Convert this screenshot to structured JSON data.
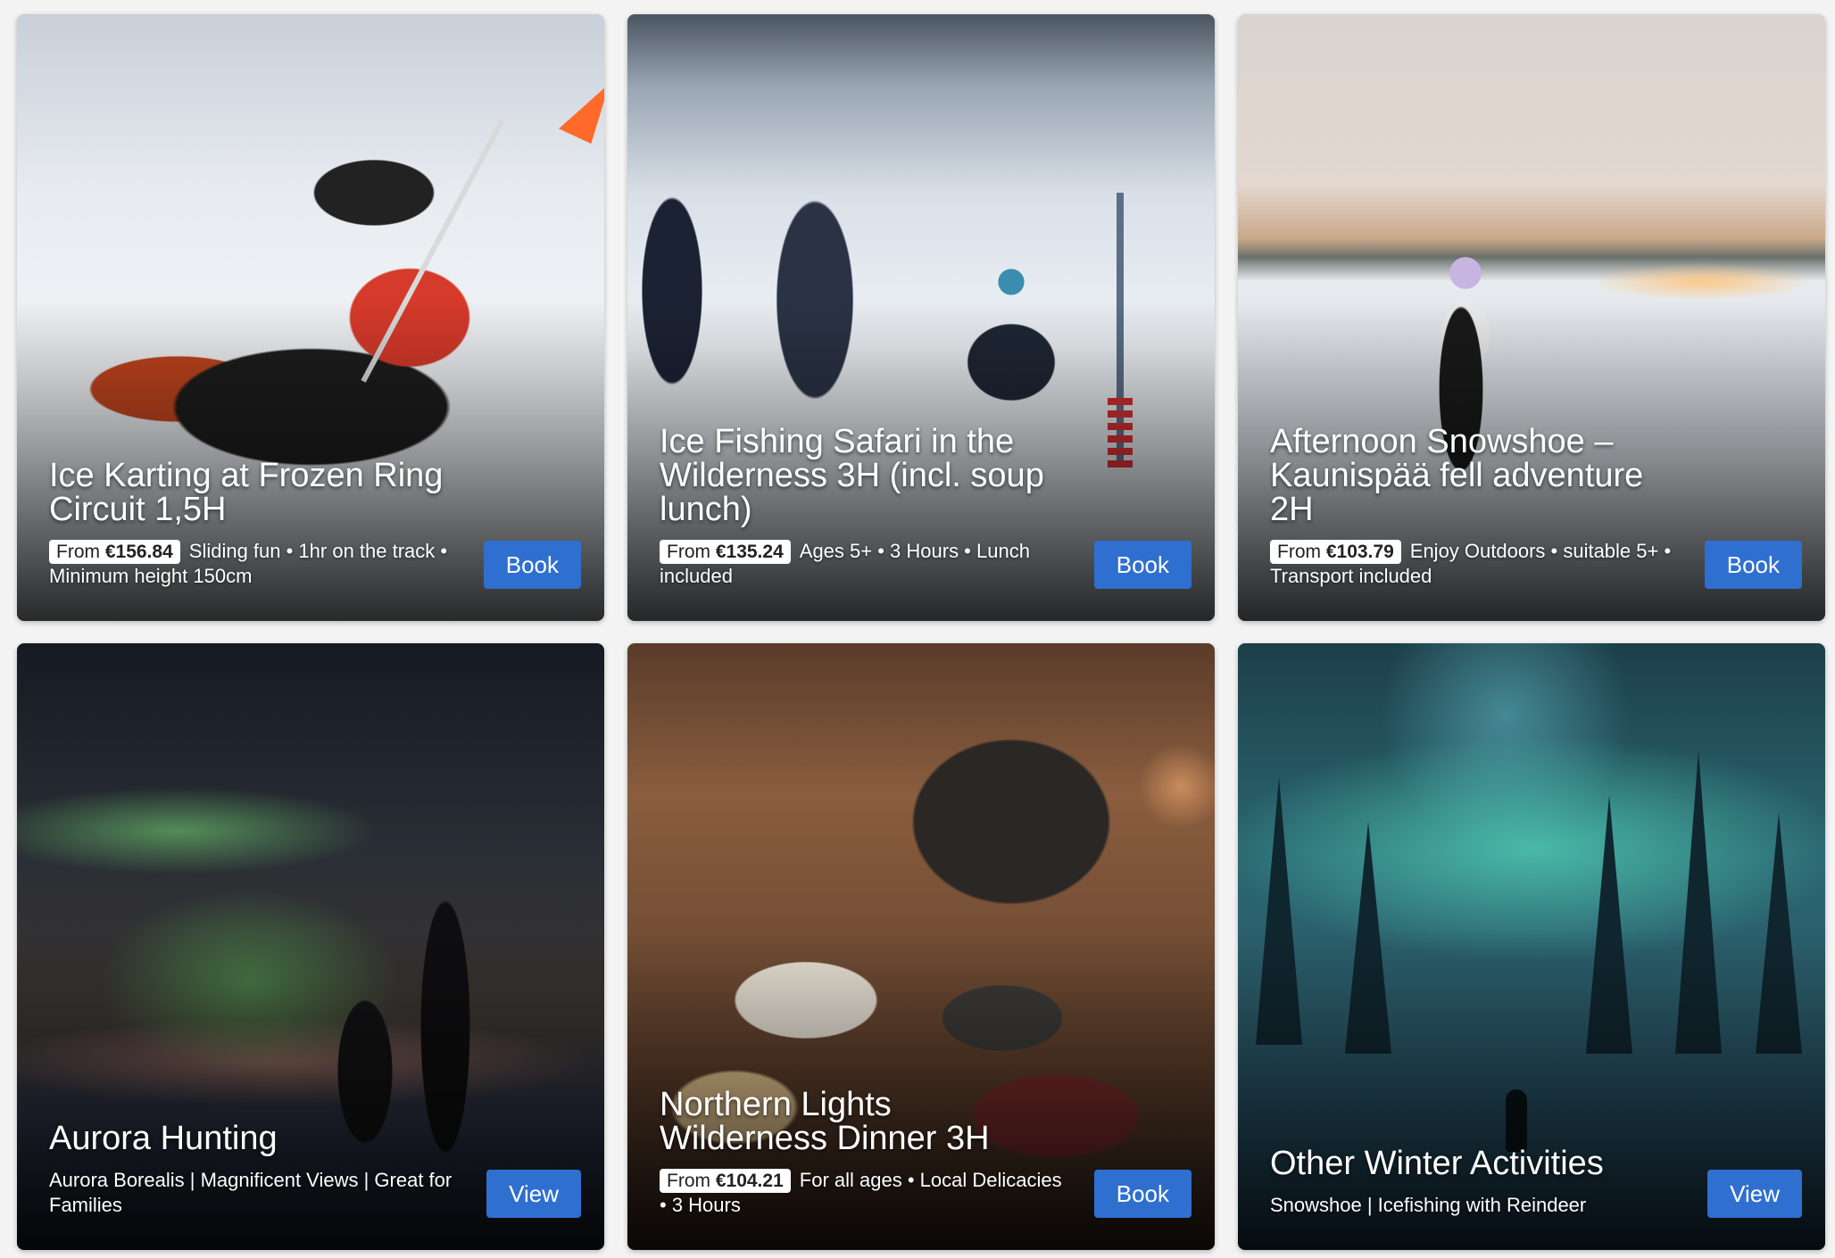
{
  "cards": [
    {
      "title": "Ice Karting at Frozen Ring Circuit 1,5H",
      "price_prefix": "From",
      "price": "€156.84",
      "description": "Sliding fun • 1hr on the track • Minimum height 150cm",
      "button": "Book"
    },
    {
      "title": "Ice Fishing Safari in the Wilderness 3H (incl. soup lunch)",
      "price_prefix": "From",
      "price": "€135.24",
      "description": "Ages 5+ • 3 Hours • Lunch included",
      "button": "Book"
    },
    {
      "title": "Afternoon Snowshoe – Kaunispää fell adventure 2H",
      "price_prefix": "From",
      "price": "€103.79",
      "description": "Enjoy Outdoors • suitable 5+ • Transport included",
      "button": "Book"
    },
    {
      "title": "Aurora Hunting",
      "description": "Aurora Borealis | Magnificent Views | Great for Families",
      "button": "View"
    },
    {
      "title": "Northern Lights Wilderness Dinner 3H",
      "price_prefix": "From",
      "price": "€104.21",
      "description": "For all ages • Local Delicacies • 3 Hours",
      "button": "Book"
    },
    {
      "title": "Other Winter Activities",
      "description": "Snowshoe | Icefishing with Reindeer",
      "button": "View"
    }
  ],
  "colors": {
    "button": "#2f6fd0",
    "price_badge_bg": "#ffffff",
    "page_bg": "#f3f3f3"
  }
}
